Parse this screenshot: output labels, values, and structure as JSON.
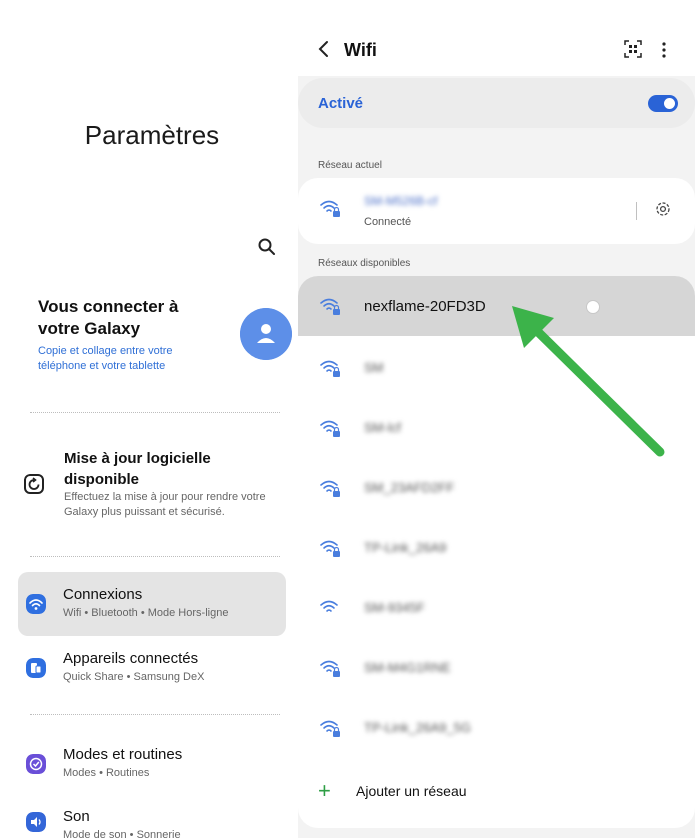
{
  "settings": {
    "title": "Paramètres",
    "promo": {
      "title": "Vous connecter à votre Galaxy",
      "subtitle": "Copie et collage entre votre téléphone et votre tablette"
    },
    "update": {
      "title": "Mise à jour logicielle disponible",
      "subtitle": "Effectuez la mise à jour pour rendre votre Galaxy plus puissant et sécurisé."
    },
    "menu": [
      {
        "label": "Connexions",
        "sub": "Wifi • Bluetooth • Mode Hors-ligne",
        "icon": "wifi-icon",
        "color": "#2f6fe0"
      },
      {
        "label": "Appareils connectés",
        "sub": "Quick Share • Samsung DeX",
        "icon": "devices-icon",
        "color": "#2f6fe0"
      },
      {
        "label": "Modes et routines",
        "sub": "Modes • Routines",
        "icon": "check-circle-icon",
        "color": "#6a4fd8"
      },
      {
        "label": "Son",
        "sub": "Mode de son • Sonnerie",
        "icon": "speaker-icon",
        "color": "#3466d8"
      }
    ]
  },
  "wifi": {
    "title": "Wifi",
    "active_label": "Activé",
    "toggle_on": true,
    "current_section": "Réseau actuel",
    "current": {
      "name": "SM-M526B-cf",
      "status": "Connecté"
    },
    "available_section": "Réseaux disponibles",
    "networks": [
      {
        "name": "nexflame-20FD3D",
        "locked": true,
        "blurred": false
      },
      {
        "name": "SM",
        "locked": true,
        "blurred": true
      },
      {
        "name": "SM-lcf",
        "locked": true,
        "blurred": true
      },
      {
        "name": "SM_23AFD2FF",
        "locked": true,
        "blurred": true
      },
      {
        "name": "TP-Link_26A9",
        "locked": true,
        "blurred": true
      },
      {
        "name": "SM-9345F",
        "locked": false,
        "blurred": true
      },
      {
        "name": "SM-M4G1RNE",
        "locked": true,
        "blurred": true
      },
      {
        "name": "TP-Link_26A9_5G",
        "locked": true,
        "blurred": true
      }
    ],
    "add_network": "Ajouter un réseau"
  },
  "annotation_color": "#3cb34a"
}
